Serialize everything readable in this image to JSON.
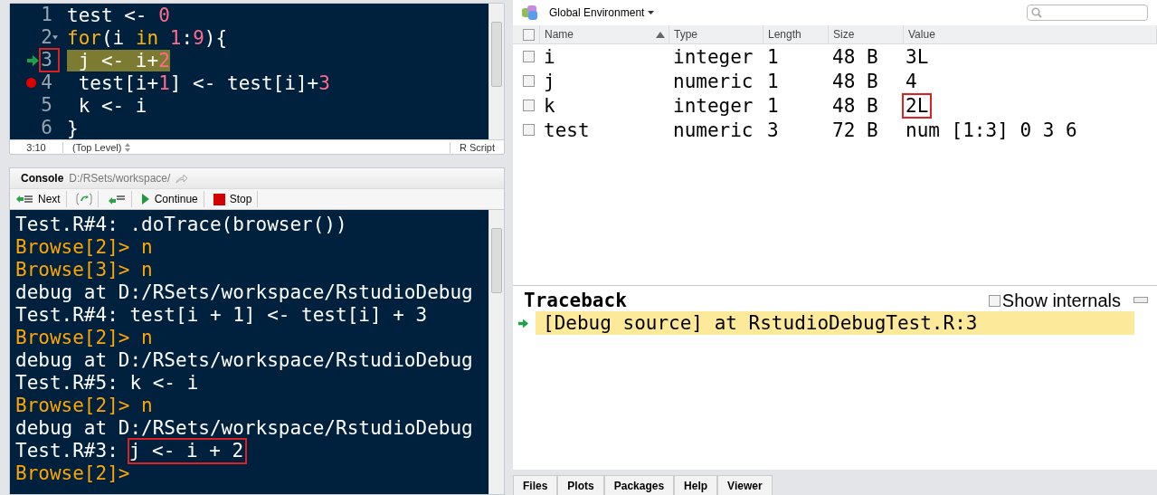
{
  "editor": {
    "lines": [
      {
        "number": "1",
        "current": false,
        "breakpoint": false,
        "foldable": false,
        "tokens": [
          {
            "kind": "plain",
            "text": "test <- "
          },
          {
            "kind": "number",
            "text": "0"
          }
        ]
      },
      {
        "number": "2",
        "current": false,
        "breakpoint": false,
        "foldable": true,
        "tokens": [
          {
            "kind": "keyword",
            "text": "for"
          },
          {
            "kind": "plain",
            "text": "(i "
          },
          {
            "kind": "keyword",
            "text": "in "
          },
          {
            "kind": "number",
            "text": "1"
          },
          {
            "kind": "plain",
            "text": ":"
          },
          {
            "kind": "number",
            "text": "9"
          },
          {
            "kind": "plain",
            "text": "){"
          }
        ]
      },
      {
        "number": "3",
        "current": true,
        "breakpoint": false,
        "foldable": false,
        "tokens": [
          {
            "kind": "plain",
            "text": " j <- i+"
          },
          {
            "kind": "number",
            "text": "2"
          }
        ]
      },
      {
        "number": "4",
        "current": false,
        "breakpoint": true,
        "foldable": false,
        "tokens": [
          {
            "kind": "plain",
            "text": " test[i+"
          },
          {
            "kind": "number",
            "text": "1"
          },
          {
            "kind": "plain",
            "text": "] <- test[i]+"
          },
          {
            "kind": "number",
            "text": "3"
          }
        ]
      },
      {
        "number": "5",
        "current": false,
        "breakpoint": false,
        "foldable": false,
        "tokens": [
          {
            "kind": "plain",
            "text": " k <- i"
          }
        ]
      },
      {
        "number": "6",
        "current": false,
        "breakpoint": false,
        "foldable": false,
        "tokens": [
          {
            "kind": "plain",
            "text": "}"
          }
        ]
      }
    ],
    "status": {
      "position": "3:10",
      "scope": "(Top Level)",
      "file_type": "R Script"
    }
  },
  "console": {
    "title": "Console",
    "path": "D:/RSets/workspace/",
    "toolbar": [
      {
        "kind": "next",
        "label": "Next"
      },
      {
        "kind": "step"
      },
      {
        "kind": "finish"
      },
      {
        "kind": "continue",
        "label": "Continue"
      },
      {
        "kind": "stop",
        "label": "Stop"
      }
    ],
    "lines": [
      {
        "kind": "output",
        "text": "Test.R#4: .doTrace(browser())"
      },
      {
        "kind": "prompt",
        "text": "Browse[2]> n"
      },
      {
        "kind": "prompt",
        "text": "Browse[3]> n"
      },
      {
        "kind": "output",
        "text": "debug at D:/RSets/workspace/RstudioDebug"
      },
      {
        "kind": "output",
        "text": "Test.R#4: test[i + 1] <- test[i] + 3"
      },
      {
        "kind": "prompt",
        "text": "Browse[2]> n"
      },
      {
        "kind": "output",
        "text": "debug at D:/RSets/workspace/RstudioDebug"
      },
      {
        "kind": "output",
        "text": "Test.R#5: k <- i"
      },
      {
        "kind": "prompt",
        "text": "Browse[2]> n"
      },
      {
        "kind": "output",
        "text": "debug at D:/RSets/workspace/RstudioDebug"
      },
      {
        "kind": "output",
        "text": "Test.R#3:",
        "marked": "j <- i + 2"
      },
      {
        "kind": "prompt",
        "text": "Browse[2]>"
      }
    ]
  },
  "environment": {
    "scope": "Global Environment",
    "all_checked": false,
    "columns": [
      "Name",
      "Type",
      "Length",
      "Size",
      "Value"
    ],
    "rows": [
      {
        "checked": false,
        "name": "i",
        "type": "integer",
        "length": "1",
        "size": "48 B",
        "value": "3L",
        "marked": false
      },
      {
        "checked": false,
        "name": "j",
        "type": "numeric",
        "length": "1",
        "size": "48 B",
        "value": "4",
        "marked": false
      },
      {
        "checked": false,
        "name": "k",
        "type": "integer",
        "length": "1",
        "size": "48 B",
        "value": "2L",
        "marked": true
      },
      {
        "checked": false,
        "name": "test",
        "type": "numeric",
        "length": "3",
        "size": "72 B",
        "value": "num [1:3] 0 3 6",
        "marked": false
      }
    ]
  },
  "traceback": {
    "title": "Traceback",
    "show_internals": {
      "label": "Show internals",
      "checked": false
    },
    "frames": [
      {
        "text": "[Debug source] at RstudioDebugTest.R:3",
        "selected": true
      }
    ]
  },
  "bottom_tabs": [
    {
      "label": "Files",
      "selected": false
    },
    {
      "label": "Plots",
      "selected": false
    },
    {
      "label": "Packages",
      "selected": false
    },
    {
      "label": "Help",
      "selected": false
    },
    {
      "label": "Viewer",
      "selected": false
    }
  ]
}
